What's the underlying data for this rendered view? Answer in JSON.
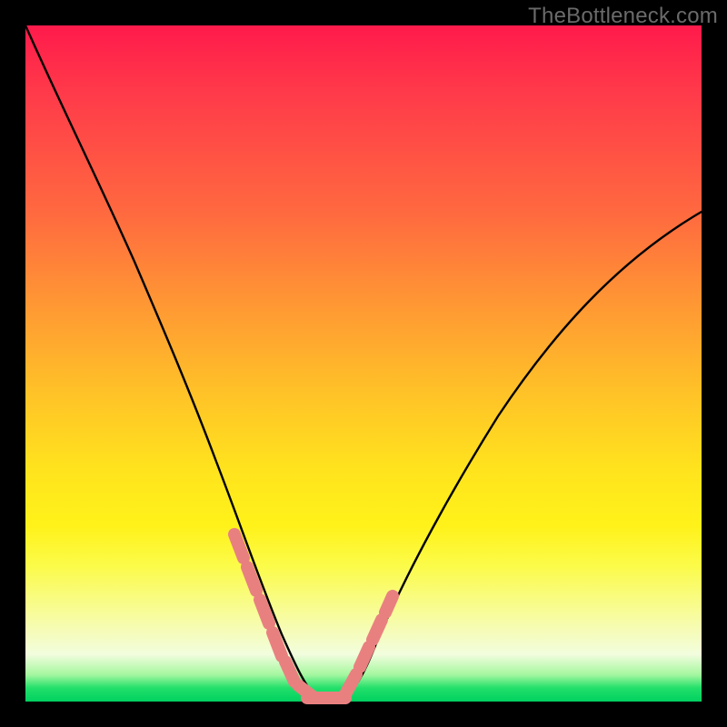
{
  "attribution": "TheBottleneck.com",
  "chart_data": {
    "type": "line",
    "title": "",
    "xlabel": "",
    "ylabel": "",
    "ylim": [
      0,
      100
    ],
    "xlim": [
      0,
      100
    ],
    "series": [
      {
        "name": "bottleneck-curve",
        "x": [
          0,
          2,
          5,
          8,
          12,
          16,
          20,
          23,
          26,
          29,
          32,
          34,
          36,
          38,
          40,
          42,
          44,
          46,
          48,
          50,
          55,
          60,
          65,
          70,
          75,
          80,
          85,
          90,
          95,
          100
        ],
        "values": [
          100,
          93,
          85,
          77,
          68,
          59,
          50,
          43,
          36,
          29,
          22,
          17,
          12,
          7,
          3,
          1,
          0,
          0,
          1,
          3,
          9,
          17,
          25,
          33,
          41,
          48,
          55,
          61,
          67,
          72
        ]
      }
    ],
    "highlight_segments": [
      {
        "x_start": 29,
        "x_end": 38,
        "note": "descending near-floor band"
      },
      {
        "x_start": 48,
        "x_end": 52,
        "note": "ascending near-floor band"
      }
    ],
    "gradient_stops": [
      {
        "pos": 0,
        "color": "#ff1a4b"
      },
      {
        "pos": 28,
        "color": "#ff6a3f"
      },
      {
        "pos": 55,
        "color": "#ffc427"
      },
      {
        "pos": 74,
        "color": "#fff21a"
      },
      {
        "pos": 93,
        "color": "#f2fdde"
      },
      {
        "pos": 100,
        "color": "#00d060"
      }
    ]
  }
}
